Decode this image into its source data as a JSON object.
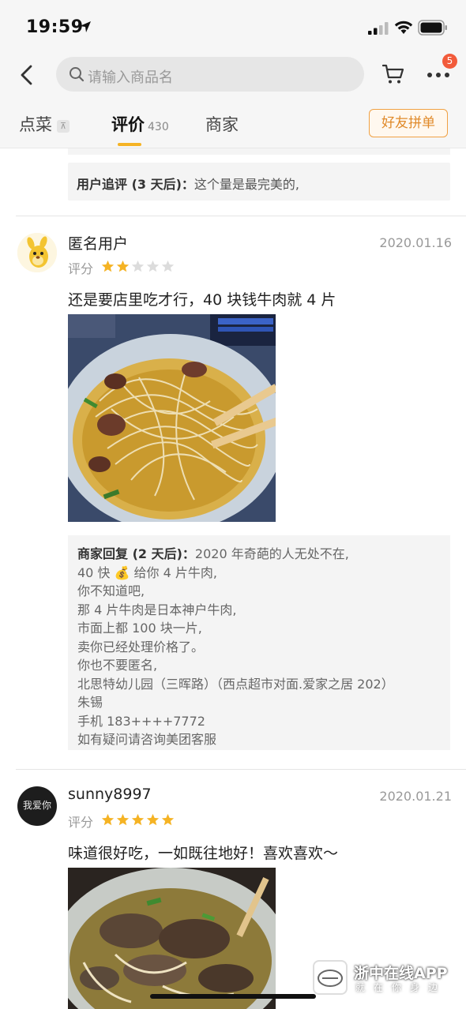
{
  "status_bar": {
    "time": "19:59"
  },
  "nav": {
    "search_placeholder": "请输入商品名",
    "more_badge": "5"
  },
  "tabs": {
    "dish": "点菜",
    "dish_pin": "⊼",
    "review": "评价",
    "review_count": "430",
    "merchant": "商家",
    "group_order": "好友拼单"
  },
  "followup": {
    "label": "用户追评 (3 天后)：",
    "text": "这个量是最完美的,"
  },
  "reviews": [
    {
      "user": "匿名用户",
      "date": "2020.01.16",
      "rating_label": "评分",
      "rating": 2,
      "text": "还是要店里吃才行，40 块钱牛肉就 4 片",
      "reply_label": "商家回复 (2 天后)：",
      "reply_lines": [
        "2020 年奇葩的人无处不在,",
        "40 快 💰 给你 4 片牛肉,",
        "你不知道吧,",
        "那 4 片牛肉是日本神户牛肉,",
        "市面上都 100 块一片,",
        "卖你已经处理价格了。",
        "你也不要匿名,",
        "北思特幼儿园（三晖路）（西点超市对面.爱家之居 202）",
        "朱锡",
        "手机 183++++7772",
        "如有疑问请咨询美团客服"
      ]
    },
    {
      "user": "sunny8997",
      "avatar_text": "我爱你",
      "date": "2020.01.21",
      "rating_label": "评分",
      "rating": 5,
      "text": "味道很好吃，一如既往地好！喜欢喜欢～"
    }
  ],
  "watermark": {
    "title": "浙中在线APP",
    "subtitle": "就在你身边"
  },
  "colors": {
    "accent": "#f5b324",
    "star_on": "#f5b324",
    "star_off": "#dcdcdc",
    "badge": "#f25b3b"
  }
}
